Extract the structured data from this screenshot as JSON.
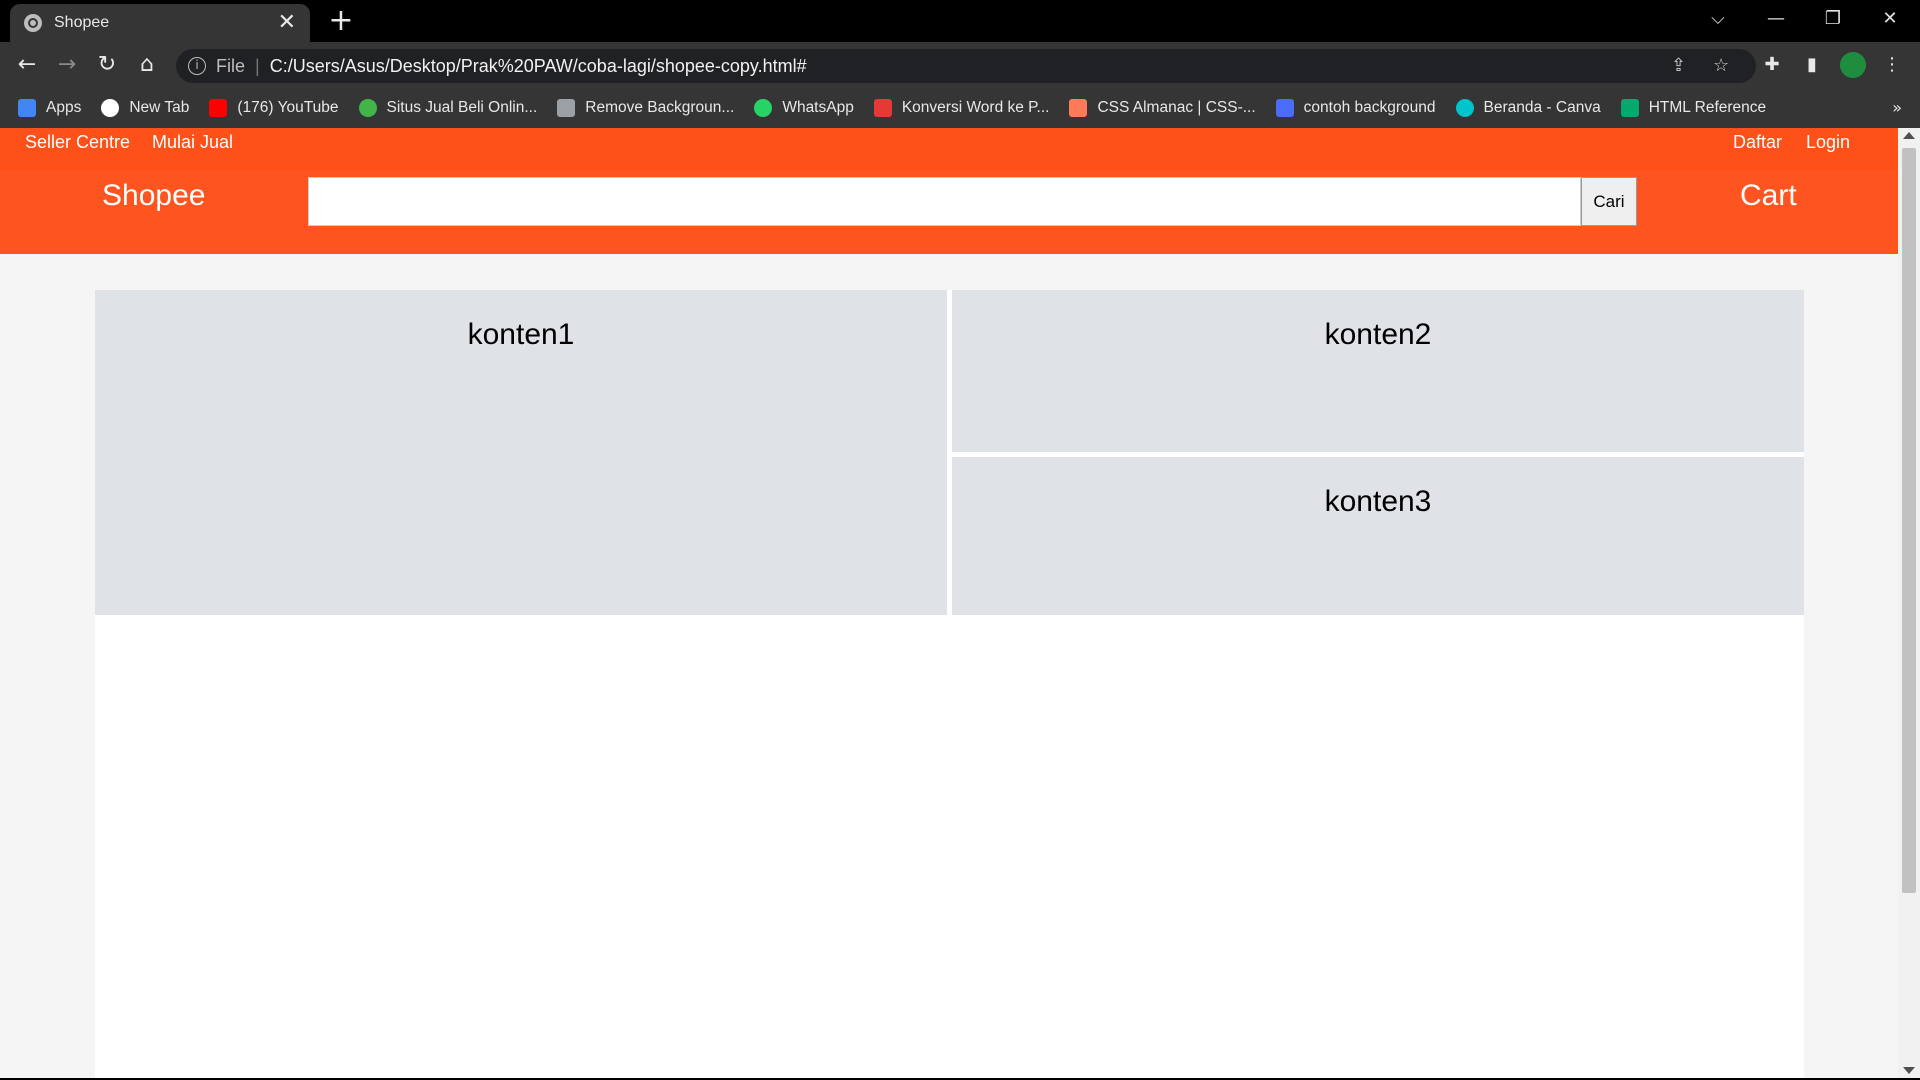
{
  "browser": {
    "tab_title": "Shopee",
    "tab_close": "✕",
    "new_tab": "+",
    "window_controls": {
      "dropdown": "⌵",
      "minimize": "—",
      "restore": "❐",
      "close": "✕"
    },
    "nav": {
      "back": "←",
      "forward": "→",
      "reload": "↻",
      "home": "⌂"
    },
    "address": {
      "info": "i",
      "scheme_label": "File",
      "separator": "|",
      "url": "C:/Users/Asus/Desktop/Prak%20PAW/coba-lagi/shopee-copy.html#"
    },
    "bookmarks": [
      {
        "label": "Apps",
        "icon": "apps-grid-icon",
        "color": "#4285f4"
      },
      {
        "label": "New Tab",
        "icon": "globe-icon",
        "color": "#ffffff"
      },
      {
        "label": "(176) YouTube",
        "icon": "youtube-icon",
        "color": "#ff0000"
      },
      {
        "label": "Situs Jual Beli Onlin...",
        "icon": "tokopedia-icon",
        "color": "#42b549"
      },
      {
        "label": "Remove Backgroun...",
        "icon": "removebg-icon",
        "color": "#9aa0a6"
      },
      {
        "label": "WhatsApp",
        "icon": "whatsapp-icon",
        "color": "#25d366"
      },
      {
        "label": "Konversi Word ke P...",
        "icon": "pdf-heart-icon",
        "color": "#e53935"
      },
      {
        "label": "CSS Almanac | CSS-...",
        "icon": "css-tricks-icon",
        "color": "#ff7a59"
      },
      {
        "label": "contoh background",
        "icon": "doc-icon",
        "color": "#4a6cf7"
      },
      {
        "label": "Beranda - Canva",
        "icon": "canva-icon",
        "color": "#00c4cc"
      },
      {
        "label": "HTML Reference",
        "icon": "w3-icon",
        "color": "#04aa6d"
      }
    ],
    "bookmarks_more": "»"
  },
  "page": {
    "topnav": {
      "seller_centre": "Seller Centre",
      "mulai_jual": "Mulai Jual",
      "daftar": "Daftar",
      "login": "Login"
    },
    "logo": "Shopee",
    "search": {
      "value": "",
      "placeholder": "",
      "button": "Cari"
    },
    "cart": "Cart",
    "contents": [
      "konten1",
      "konten2",
      "konten3"
    ],
    "colors": {
      "brand": "#fd5420",
      "box": "#dfe3e7"
    }
  }
}
